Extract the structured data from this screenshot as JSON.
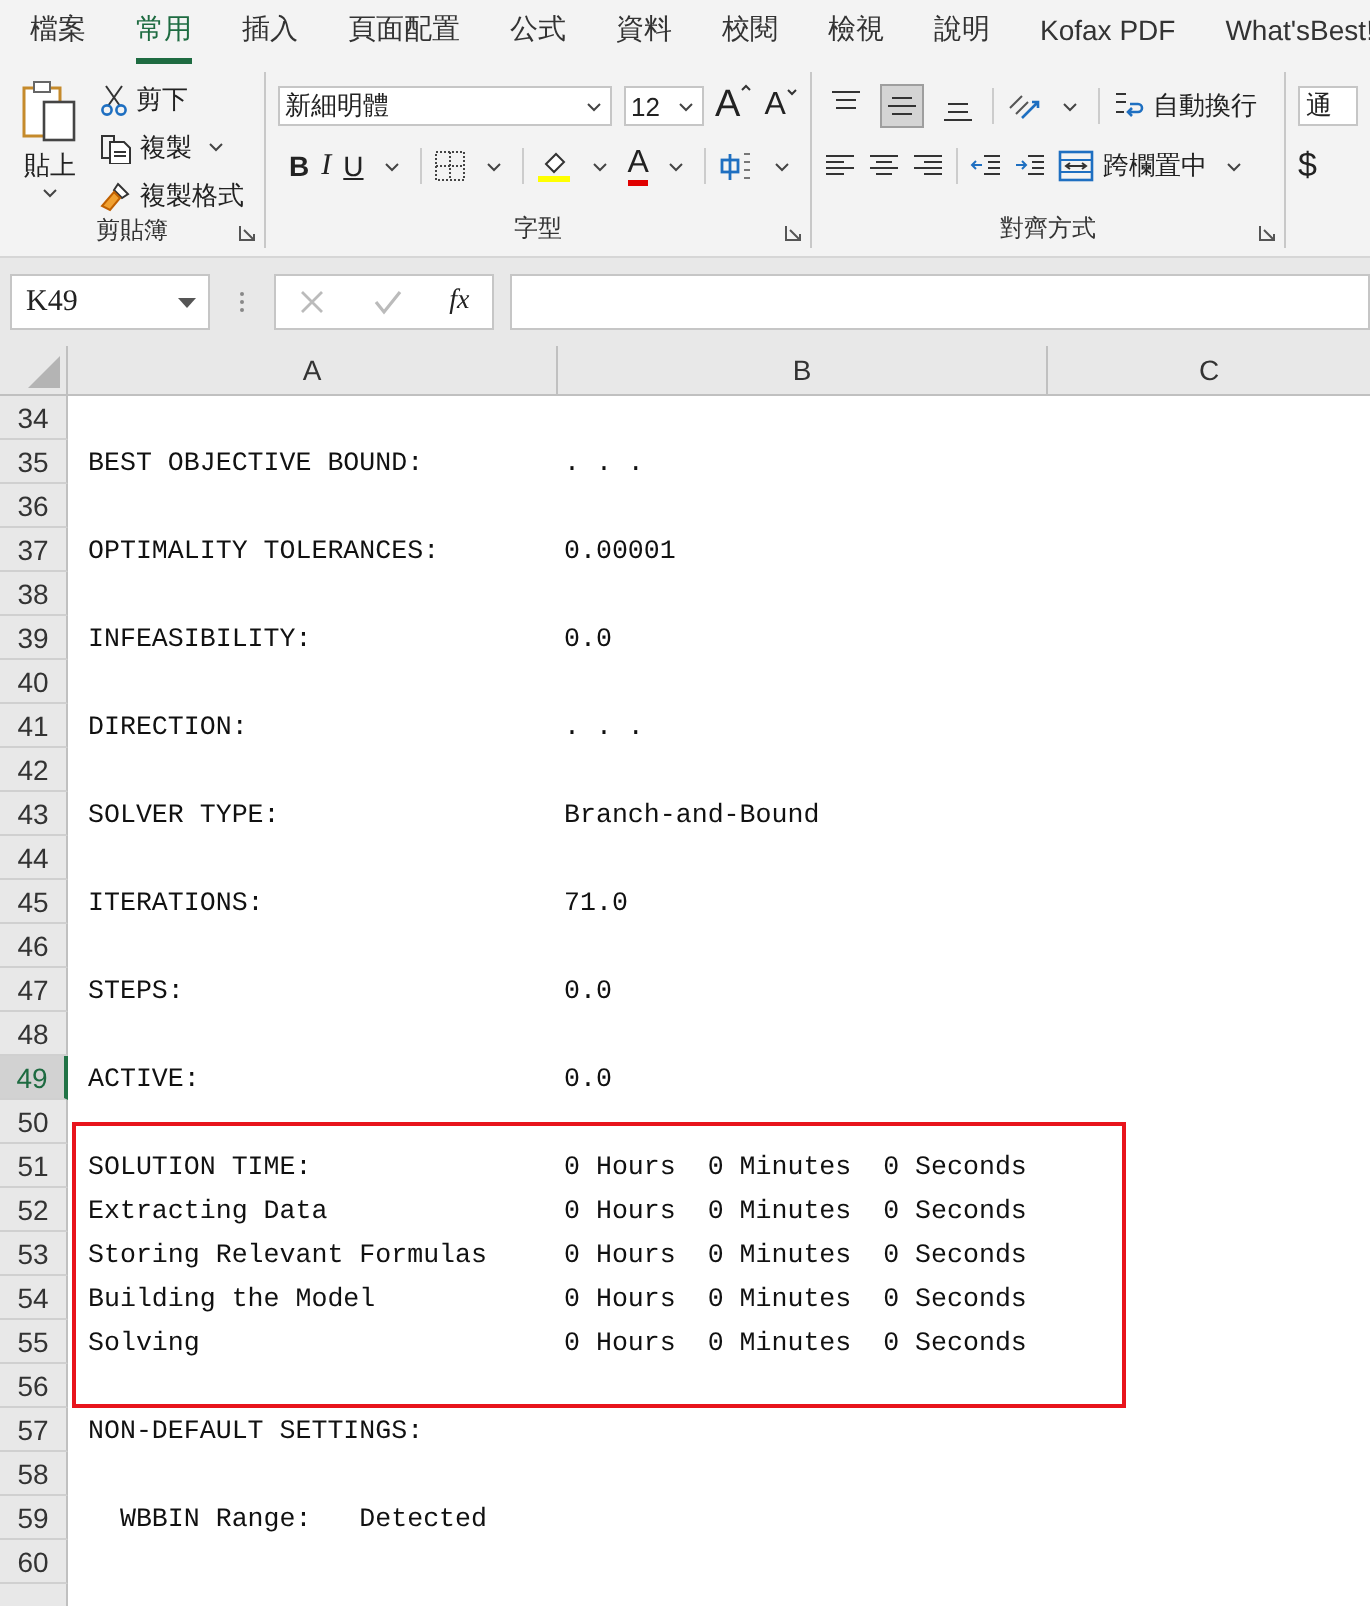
{
  "tabs": [
    {
      "label": "檔案",
      "selected": false
    },
    {
      "label": "常用",
      "selected": true
    },
    {
      "label": "插入",
      "selected": false
    },
    {
      "label": "頁面配置",
      "selected": false
    },
    {
      "label": "公式",
      "selected": false
    },
    {
      "label": "資料",
      "selected": false
    },
    {
      "label": "校閱",
      "selected": false
    },
    {
      "label": "檢視",
      "selected": false
    },
    {
      "label": "說明",
      "selected": false
    },
    {
      "label": "Kofax PDF",
      "selected": false
    },
    {
      "label": "What'sBest!",
      "selected": false
    }
  ],
  "ribbon": {
    "clipboard": {
      "paste": "貼上",
      "cut": "剪下",
      "copy": "複製",
      "format_painter": "複製格式",
      "group_label": "剪貼簿"
    },
    "font": {
      "font_name": "新細明體",
      "font_size": "12",
      "grow": "A",
      "shrink": "A",
      "bold": "B",
      "italic": "I",
      "underline": "U",
      "font_color": "A",
      "group_label": "字型"
    },
    "alignment": {
      "vertical": [
        {
          "kind": "top",
          "selected": false
        },
        {
          "kind": "middle",
          "selected": true
        },
        {
          "kind": "bottom",
          "selected": false
        }
      ],
      "wrap_text": "自動換行",
      "merge_center": "跨欄置中",
      "group_label": "對齊方式"
    },
    "number": {
      "format": "通",
      "currency": "$"
    }
  },
  "formula_bar": {
    "name_box": "K49",
    "fx": "fx"
  },
  "columns": [
    {
      "label": "A"
    },
    {
      "label": "B"
    },
    {
      "label": "C"
    }
  ],
  "rows": [
    {
      "kind": "row",
      "number": "34",
      "selected": false
    },
    {
      "kind": "row",
      "number": "35",
      "selected": false,
      "a": "BEST OBJECTIVE BOUND:",
      "b": ". . ."
    },
    {
      "kind": "row",
      "number": "36",
      "selected": false
    },
    {
      "kind": "row",
      "number": "37",
      "selected": false,
      "a": "OPTIMALITY TOLERANCES:",
      "b": "0.00001"
    },
    {
      "kind": "row",
      "number": "38",
      "selected": false
    },
    {
      "kind": "row",
      "number": "39",
      "selected": false,
      "a": "INFEASIBILITY:",
      "b": "0.0"
    },
    {
      "kind": "row",
      "number": "40",
      "selected": false
    },
    {
      "kind": "row",
      "number": "41",
      "selected": false,
      "a": "DIRECTION:",
      "b": ". . ."
    },
    {
      "kind": "row",
      "number": "42",
      "selected": false
    },
    {
      "kind": "row",
      "number": "43",
      "selected": false,
      "a": "SOLVER TYPE:",
      "b": "Branch-and-Bound"
    },
    {
      "kind": "row",
      "number": "44",
      "selected": false
    },
    {
      "kind": "row",
      "number": "45",
      "selected": false,
      "a": "ITERATIONS:",
      "b": "71.0"
    },
    {
      "kind": "row",
      "number": "46",
      "selected": false
    },
    {
      "kind": "row",
      "number": "47",
      "selected": false,
      "a": "STEPS:",
      "b": "0.0"
    },
    {
      "kind": "row",
      "number": "48",
      "selected": false
    },
    {
      "kind": "row",
      "number": "49",
      "selected": true,
      "a": "ACTIVE:",
      "b": "0.0"
    },
    {
      "kind": "row",
      "number": "50",
      "selected": false
    },
    {
      "kind": "boxed_group",
      "rows": [
        {
          "number": "51",
          "selected": false,
          "a": "SOLUTION TIME:",
          "b": "0 Hours  0 Minutes  0 Seconds"
        },
        {
          "number": "52",
          "selected": false,
          "a": "Extracting Data",
          "b": "0 Hours  0 Minutes  0 Seconds"
        },
        {
          "number": "53",
          "selected": false,
          "a": "Storing Relevant Formulas",
          "b": "0 Hours  0 Minutes  0 Seconds"
        },
        {
          "number": "54",
          "selected": false,
          "a": "Building the Model",
          "b": "0 Hours  0 Minutes  0 Seconds"
        },
        {
          "number": "55",
          "selected": false,
          "a": "Solving",
          "b": "0 Hours  0 Minutes  0 Seconds"
        },
        {
          "number": "56",
          "selected": false
        }
      ]
    },
    {
      "kind": "row",
      "number": "57",
      "selected": false,
      "a": "NON-DEFAULT SETTINGS:"
    },
    {
      "kind": "row",
      "number": "58",
      "selected": false
    },
    {
      "kind": "row",
      "number": "59",
      "selected": false,
      "a": "  WBBIN Range:   Detected"
    },
    {
      "kind": "row",
      "number": "60",
      "selected": false
    }
  ]
}
